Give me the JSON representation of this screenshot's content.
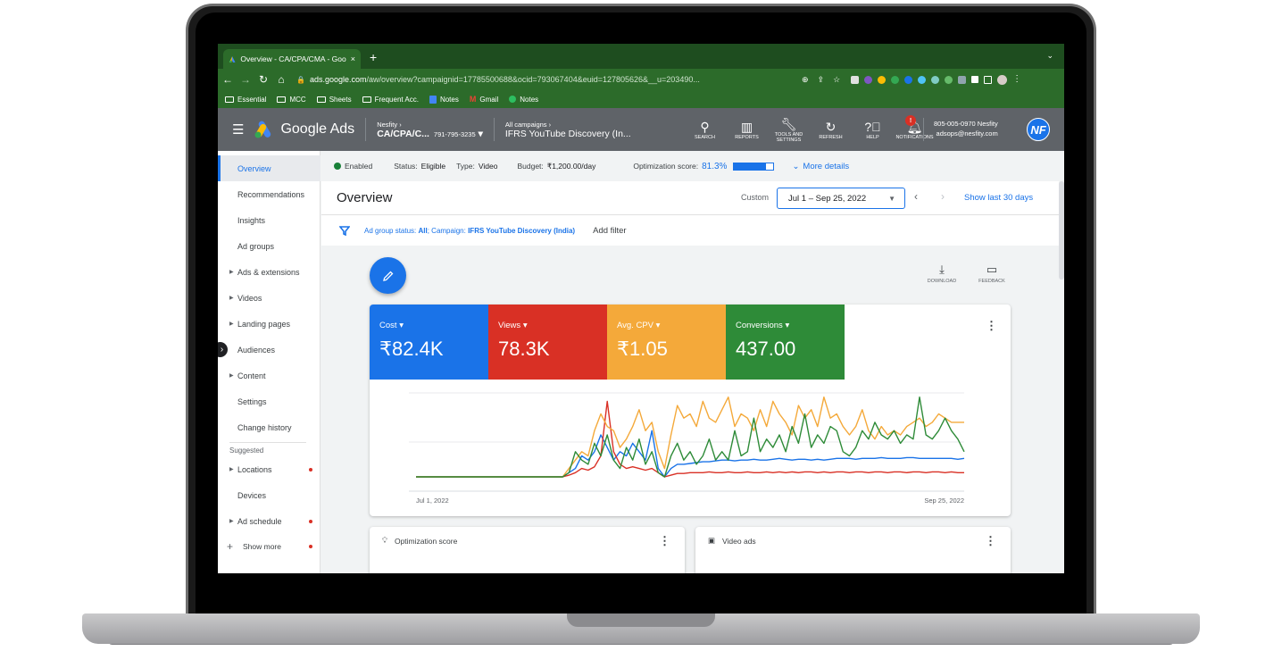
{
  "browser": {
    "tab_title": "Overview - CA/CPA/CMA - Goo",
    "tab_close": "×",
    "new_tab": "+",
    "url_domain": "ads.google.com",
    "url_rest": "/aw/overview?campaignid=17785500688&ocid=793067404&euid=127805626&__u=203490...",
    "bookmarks": [
      "Essential",
      "MCC",
      "Sheets",
      "Frequent Acc.",
      "Notes",
      "Gmail",
      "Notes"
    ]
  },
  "header": {
    "product": "Google Ads",
    "account_parent": "Nesfity",
    "account_name": "CA/CPA/C...",
    "account_id": "791-795-3235",
    "campaign_parent": "All campaigns",
    "campaign_name": "IFRS YouTube Discovery (In...",
    "tools": [
      "SEARCH",
      "REPORTS",
      "TOOLS AND SETTINGS",
      "REFRESH",
      "HELP",
      "NOTIFICATIONS"
    ],
    "notification_count": "!",
    "account_line1": "805-005-0970 Nesfity",
    "account_line2": "adsops@nesfity.com",
    "avatar_initials": "NF"
  },
  "sidebar": {
    "items": [
      "Overview",
      "Recommendations",
      "Insights",
      "Ad groups",
      "Ads & extensions",
      "Videos",
      "Landing pages",
      "Audiences",
      "Content",
      "Settings",
      "Change history"
    ],
    "suggested_label": "Suggested",
    "suggested": [
      "Locations",
      "Devices",
      "Ad schedule"
    ],
    "show_more": "Show more"
  },
  "status": {
    "state": "Enabled",
    "status_label": "Status:",
    "status_value": "Eligible",
    "type_label": "Type:",
    "type_value": "Video",
    "budget_label": "Budget:",
    "budget_value": "₹1,200.00/day",
    "opt_label": "Optimization score:",
    "opt_value": "81.3%",
    "opt_fraction": 0.813,
    "more_details": "More details"
  },
  "overview": {
    "title": "Overview",
    "custom_label": "Custom",
    "date_range": "Jul 1 – Sep 25, 2022",
    "show_last": "Show last 30 days",
    "filter_prefix": "Ad group status: ",
    "filter_all": "All",
    "filter_mid": "; Campaign: ",
    "filter_campaign": "IFRS YouTube Discovery (India)",
    "add_filter": "Add filter",
    "download": "DOWNLOAD",
    "feedback": "FEEDBACK"
  },
  "metrics": [
    {
      "label": "Cost",
      "value": "₹82.4K",
      "color": "#1a73e8"
    },
    {
      "label": "Views",
      "value": "78.3K",
      "color": "#d93025"
    },
    {
      "label": "Avg. CPV",
      "value": "₹1.05",
      "color": "#f4a93a"
    },
    {
      "label": "Conversions",
      "value": "437.00",
      "color": "#2e8b38"
    }
  ],
  "chart_data": {
    "type": "line",
    "x_start_label": "Jul 1, 2022",
    "x_end_label": "Sep 25, 2022",
    "grid": true,
    "series": [
      {
        "name": "Cost",
        "color": "#1a73e8",
        "values": [
          0,
          0,
          0,
          0,
          0,
          0,
          0,
          0,
          0,
          0,
          0,
          0,
          0,
          0,
          0,
          0,
          0,
          0,
          0,
          0,
          0,
          0,
          0,
          0,
          0.05,
          0.1,
          0.25,
          0.2,
          0.3,
          0.5,
          0.35,
          0.2,
          0.3,
          0.25,
          0.4,
          0.3,
          0.2,
          0.55,
          0.1,
          0,
          0.1,
          0.15,
          0.15,
          0.16,
          0.17,
          0.18,
          0.18,
          0.19,
          0.2,
          0.2,
          0.19,
          0.2,
          0.2,
          0.21,
          0.2,
          0.2,
          0.21,
          0.22,
          0.21,
          0.2,
          0.21,
          0.21,
          0.2,
          0.21,
          0.2,
          0.21,
          0.22,
          0.22,
          0.22,
          0.21,
          0.22,
          0.22,
          0.22,
          0.23,
          0.22,
          0.22,
          0.22,
          0.23,
          0.23,
          0.22,
          0.22,
          0.22,
          0.22,
          0.22,
          0.22,
          0.21,
          0.22
        ]
      },
      {
        "name": "Views",
        "color": "#d93025",
        "values": [
          0,
          0,
          0,
          0,
          0,
          0,
          0,
          0,
          0,
          0,
          0,
          0,
          0,
          0,
          0,
          0,
          0,
          0,
          0,
          0,
          0,
          0,
          0,
          0,
          0.02,
          0.05,
          0.1,
          0.08,
          0.12,
          0.25,
          0.9,
          0.3,
          0.15,
          0.1,
          0.12,
          0.1,
          0.08,
          0.1,
          0.05,
          0,
          0.02,
          0.04,
          0.04,
          0.05,
          0.05,
          0.05,
          0.06,
          0.05,
          0.05,
          0.06,
          0.05,
          0.05,
          0.06,
          0.05,
          0.05,
          0.06,
          0.05,
          0.06,
          0.05,
          0.06,
          0.05,
          0.06,
          0.06,
          0.05,
          0.06,
          0.05,
          0.06,
          0.06,
          0.05,
          0.06,
          0.06,
          0.05,
          0.06,
          0.06,
          0.05,
          0.06,
          0.06,
          0.05,
          0.06,
          0.06,
          0.05,
          0.06,
          0.06,
          0.05,
          0.06,
          0.05,
          0.05
        ]
      },
      {
        "name": "Avg. CPV",
        "color": "#f4a93a",
        "values": [
          0,
          0,
          0,
          0,
          0,
          0,
          0,
          0,
          0,
          0,
          0,
          0,
          0,
          0,
          0,
          0,
          0,
          0,
          0,
          0,
          0,
          0,
          0,
          0,
          0.1,
          0.2,
          0.3,
          0.25,
          0.55,
          0.75,
          0.6,
          0.55,
          0.35,
          0.45,
          0.6,
          0.8,
          0.55,
          0.65,
          0.3,
          0.1,
          0.5,
          0.85,
          0.7,
          0.75,
          0.6,
          0.9,
          0.7,
          0.65,
          0.8,
          0.95,
          0.6,
          0.75,
          0.7,
          0.55,
          0.8,
          0.6,
          0.9,
          0.75,
          0.65,
          0.5,
          0.85,
          0.7,
          0.8,
          0.6,
          0.95,
          0.7,
          0.75,
          0.6,
          0.5,
          0.6,
          0.8,
          0.55,
          0.45,
          0.6,
          0.5,
          0.55,
          0.5,
          0.6,
          0.65,
          0.7,
          0.6,
          0.65,
          0.75,
          0.7,
          0.65,
          0.65,
          0.65
        ]
      },
      {
        "name": "Conversions",
        "color": "#2e8b38",
        "values": [
          0,
          0,
          0,
          0,
          0,
          0,
          0,
          0,
          0,
          0,
          0,
          0,
          0,
          0,
          0,
          0,
          0,
          0,
          0,
          0,
          0,
          0,
          0,
          0,
          0.05,
          0.3,
          0.2,
          0.15,
          0.4,
          0.25,
          0.5,
          0.2,
          0.1,
          0.35,
          0.2,
          0.45,
          0.15,
          0.3,
          0.05,
          0,
          0.25,
          0.4,
          0.2,
          0.3,
          0.15,
          0.25,
          0.45,
          0.2,
          0.3,
          0.2,
          0.55,
          0.25,
          0.3,
          0.7,
          0.3,
          0.45,
          0.35,
          0.5,
          0.3,
          0.6,
          0.4,
          0.75,
          0.35,
          0.5,
          0.4,
          0.6,
          0.55,
          0.3,
          0.25,
          0.35,
          0.55,
          0.45,
          0.65,
          0.5,
          0.45,
          0.55,
          0.4,
          0.5,
          0.45,
          0.95,
          0.5,
          0.45,
          0.55,
          0.7,
          0.55,
          0.45,
          0.3
        ]
      }
    ]
  },
  "cards": {
    "opt_title": "Optimization score",
    "video_title": "Video ads"
  }
}
